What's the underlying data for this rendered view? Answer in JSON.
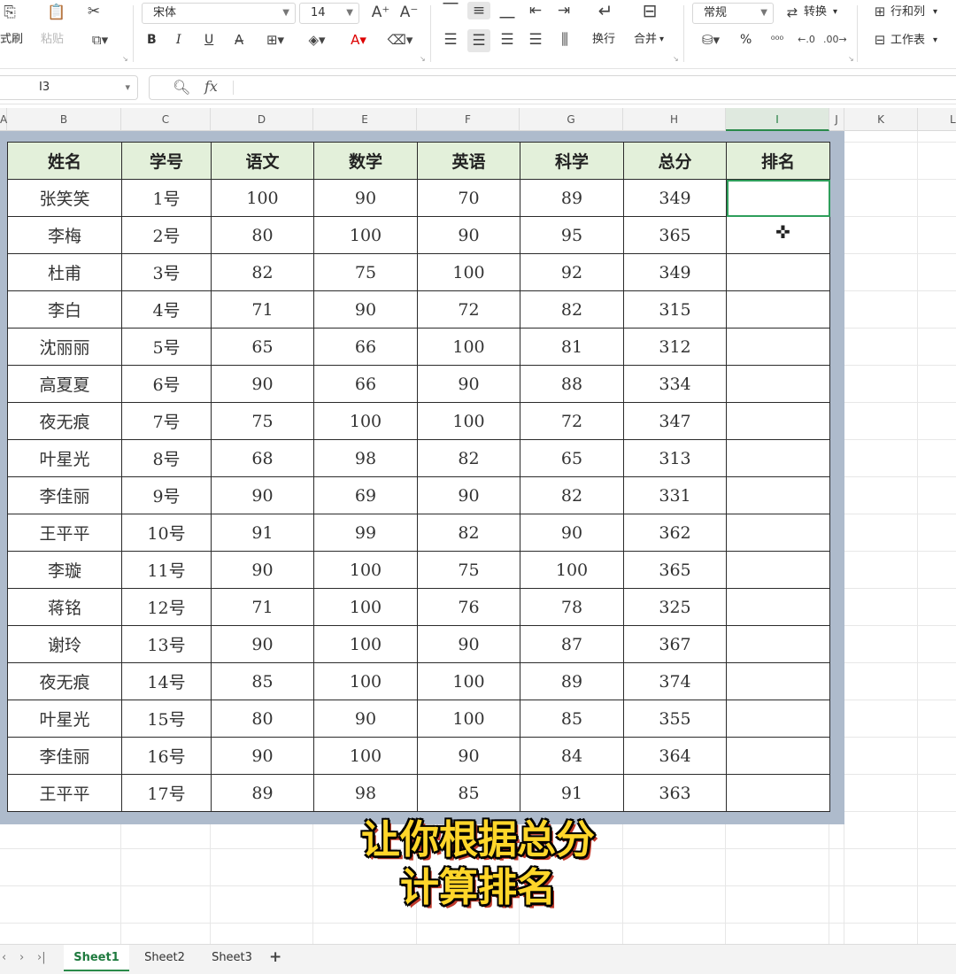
{
  "ribbon": {
    "format_painter": "式刷",
    "paste": "粘贴",
    "font_name": "宋体",
    "font_size": "14",
    "wrap_text": "换行",
    "merge": "合并",
    "number_format": "常规",
    "convert": "转换",
    "rows_cols": "行和列",
    "worksheet": "工作表",
    "bold": "B",
    "italic": "I",
    "underline": "U",
    "percent": "%"
  },
  "formula_bar": {
    "cell_ref": "I3",
    "fx": "fx"
  },
  "columns": [
    "A",
    "B",
    "C",
    "D",
    "E",
    "F",
    "G",
    "H",
    "I",
    "J",
    "K",
    "L"
  ],
  "table": {
    "headers": [
      "姓名",
      "学号",
      "语文",
      "数学",
      "英语",
      "科学",
      "总分",
      "排名"
    ],
    "rows": [
      [
        "张笑笑",
        "1号",
        "100",
        "90",
        "70",
        "89",
        "349",
        ""
      ],
      [
        "李梅",
        "2号",
        "80",
        "100",
        "90",
        "95",
        "365",
        ""
      ],
      [
        "杜甫",
        "3号",
        "82",
        "75",
        "100",
        "92",
        "349",
        ""
      ],
      [
        "李白",
        "4号",
        "71",
        "90",
        "72",
        "82",
        "315",
        ""
      ],
      [
        "沈丽丽",
        "5号",
        "65",
        "66",
        "100",
        "81",
        "312",
        ""
      ],
      [
        "高夏夏",
        "6号",
        "90",
        "66",
        "90",
        "88",
        "334",
        ""
      ],
      [
        "夜无痕",
        "7号",
        "75",
        "100",
        "100",
        "72",
        "347",
        ""
      ],
      [
        "叶星光",
        "8号",
        "68",
        "98",
        "82",
        "65",
        "313",
        ""
      ],
      [
        "李佳丽",
        "9号",
        "90",
        "69",
        "90",
        "82",
        "331",
        ""
      ],
      [
        "王平平",
        "10号",
        "91",
        "99",
        "82",
        "90",
        "362",
        ""
      ],
      [
        "李璇",
        "11号",
        "90",
        "100",
        "75",
        "100",
        "365",
        ""
      ],
      [
        "蒋铭",
        "12号",
        "71",
        "100",
        "76",
        "78",
        "325",
        ""
      ],
      [
        "谢玲",
        "13号",
        "90",
        "100",
        "90",
        "87",
        "367",
        ""
      ],
      [
        "夜无痕",
        "14号",
        "85",
        "100",
        "100",
        "89",
        "374",
        ""
      ],
      [
        "叶星光",
        "15号",
        "80",
        "90",
        "100",
        "85",
        "355",
        ""
      ],
      [
        "李佳丽",
        "16号",
        "90",
        "100",
        "90",
        "84",
        "364",
        ""
      ],
      [
        "王平平",
        "17号",
        "89",
        "98",
        "85",
        "91",
        "363",
        ""
      ]
    ]
  },
  "subtitle": {
    "line1": "让你根据总分",
    "line2": "计算排名"
  },
  "sheets": [
    "Sheet1",
    "Sheet2",
    "Sheet3"
  ],
  "active_sheet": "Sheet1",
  "colors": {
    "header_fill": "#e3f0da",
    "frame": "#aebbcc",
    "selection": "#2e9e5b",
    "subtitle_text": "#ffd62a"
  }
}
